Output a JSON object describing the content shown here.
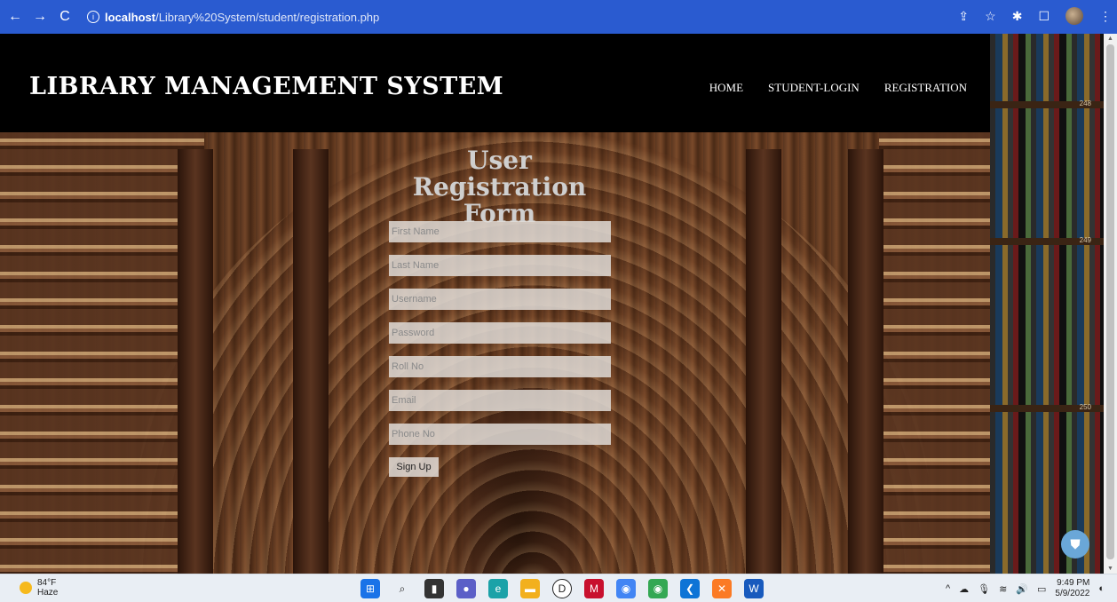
{
  "browser": {
    "back_icon": "arrow-left-icon",
    "forward_icon": "arrow-right-icon",
    "reload_icon": "reload-icon",
    "url_host": "localhost",
    "url_path": "/Library%20System/student/registration.php"
  },
  "site": {
    "title": "LIBRARY MANAGEMENT SYSTEM",
    "nav": {
      "home": "HOME",
      "student_login": "STUDENT-LOGIN",
      "registration": "REGISTRATION"
    }
  },
  "form": {
    "title": "User Registration Form",
    "fields": {
      "first_name": "First Name",
      "last_name": "Last Name",
      "username": "Username",
      "password": "Password",
      "roll_no": "Roll No",
      "email": "Email",
      "phone_no": "Phone No"
    },
    "submit_label": "Sign Up"
  },
  "shelf_labels": [
    "248",
    "249",
    "250"
  ],
  "taskbar": {
    "temperature": "84°F",
    "condition": "Haze",
    "time": "9:49 PM",
    "date": "5/9/2022"
  },
  "colors": {
    "browser_bar": "#2a5bd0",
    "header_bg": "#000000",
    "accent_fab": "#6aa7d8"
  }
}
